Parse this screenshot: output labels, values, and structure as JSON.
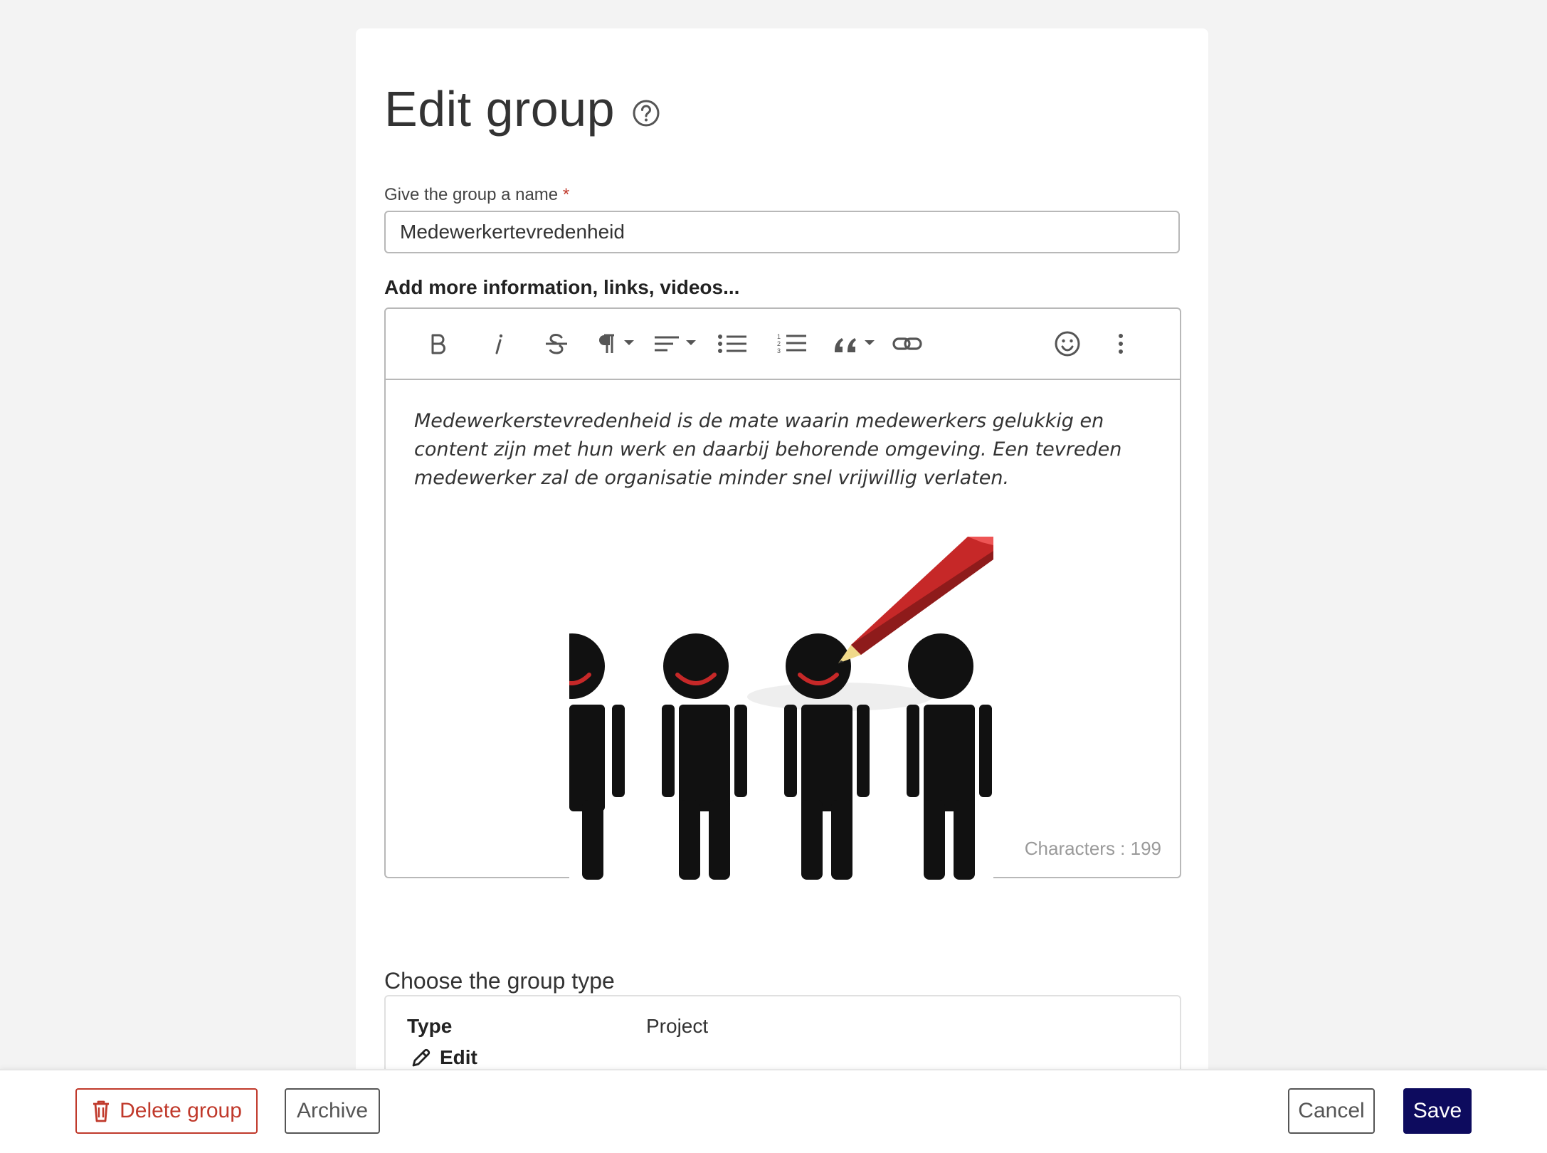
{
  "header": {
    "title": "Edit group"
  },
  "name_field": {
    "label": "Give the group a name",
    "required_mark": "*",
    "value": "Medewerkertevredenheid"
  },
  "description": {
    "label": "Add more information, links, videos...",
    "text": "Medewerkerstevredenheid is de mate waarin medewerkers gelukkig en content zijn met hun werk en daarbij behorende omgeving. Een tevreden medewerker zal de organisatie minder snel vrijwillig verlaten.",
    "char_count": "Characters : 199",
    "toolbar": [
      "bold-icon",
      "italic-icon",
      "strikethrough-icon",
      "paragraph-icon",
      "align-icon",
      "bullet-list-icon",
      "numbered-list-icon",
      "quote-icon",
      "link-icon",
      "emoji-icon",
      "more-icon"
    ]
  },
  "group_type": {
    "section_title": "Choose the group type",
    "type_label": "Type",
    "type_value": "Project",
    "edit_label": "Edit"
  },
  "footer": {
    "delete_label": "Delete group",
    "archive_label": "Archive",
    "cancel_label": "Cancel",
    "save_label": "Save"
  },
  "colors": {
    "primary": "#0d0b5e",
    "danger": "#c0392b",
    "pencil": "#c62828"
  }
}
